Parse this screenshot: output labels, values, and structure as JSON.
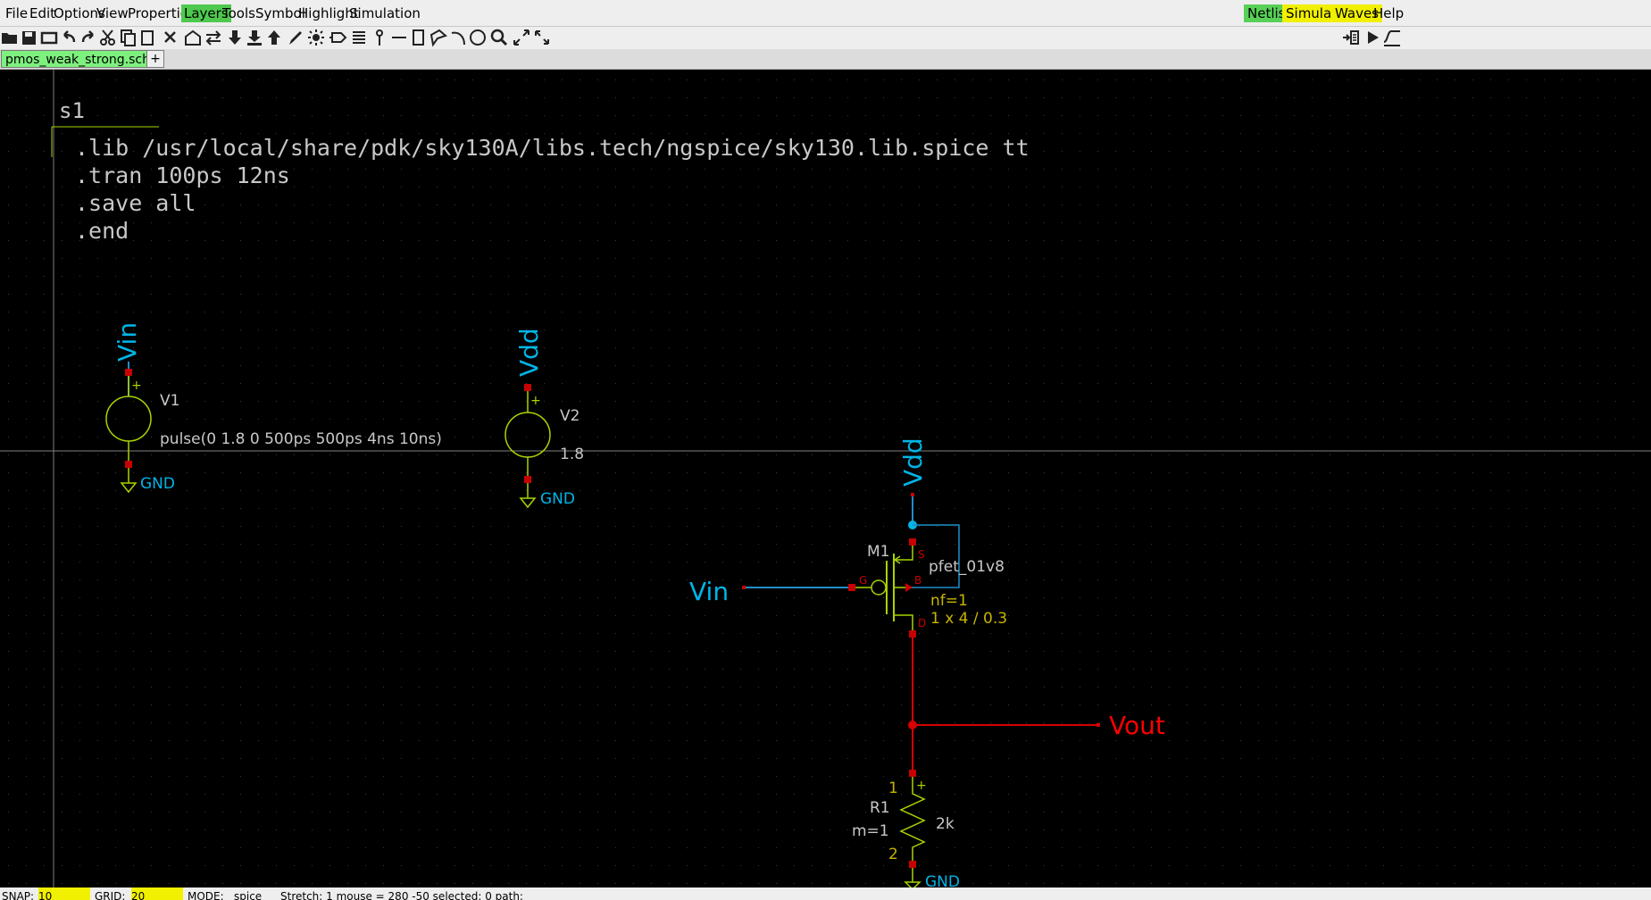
{
  "menu": {
    "items": [
      "File",
      "Edit",
      "Options",
      "View",
      "Properties",
      "Layers",
      "Tools",
      "Symbol",
      "Highlight",
      "Simulation"
    ],
    "highlighted": "Layers",
    "right_items": [
      "Netlist",
      "Simulate",
      "Waves",
      "Help"
    ]
  },
  "toolbar": {
    "icons": [
      "open-folder-icon",
      "save-icon",
      "save-as-icon",
      "undo-icon",
      "redo-icon",
      "cut-icon",
      "copy-icon",
      "delete-icon",
      "insert-symbol-icon",
      "swap-icon",
      "push-down-icon",
      "pop-icon",
      "push-up-icon",
      "pen-icon",
      "highlight-icon",
      "netlabel-icon",
      "list-icon",
      "pin-icon",
      "wire-icon",
      "rectangle-icon",
      "polygon-icon",
      "arc-icon",
      "circle-icon",
      "zoom-icon",
      "zoom-full-icon",
      "fullscreen-icon"
    ],
    "right_icons": [
      "netlist-tool-icon",
      "simulate-play-icon",
      "waves-icon"
    ]
  },
  "tabs": {
    "active": "pmos_weak_strong.sch",
    "add_label": "+"
  },
  "schematic": {
    "code_block": {
      "title": "s1",
      "lines": [
        ".lib /usr/local/share/pdk/sky130A/libs.tech/ngspice/sky130.lib.spice tt",
        ".tran 100ps 12ns",
        ".save all",
        ".end"
      ]
    },
    "v1": {
      "net_label": "Vin",
      "name": "V1",
      "value": "pulse(0 1.8 0 500ps 500ps 4ns 10ns)",
      "plus": "+",
      "gnd": "GND"
    },
    "v2": {
      "net_label": "Vdd",
      "name": "V2",
      "value": "1.8",
      "plus": "+",
      "gnd": "GND"
    },
    "m1": {
      "supply_label": "Vdd",
      "name": "M1",
      "model": "pfet_01v8",
      "nf": "nf=1",
      "size": "1 x 4 / 0.3",
      "pin_s": "S",
      "pin_g": "G",
      "pin_b": "B",
      "pin_d": "D",
      "gate_label": "Vin"
    },
    "vout_label": "Vout",
    "r1": {
      "name": "R1",
      "mult": "m=1",
      "value": "2k",
      "pin1": "1",
      "pin2": "2",
      "plus": "+",
      "gnd": "GND"
    },
    "colors": {
      "net_label": "#00b5e8",
      "wire_blue": "#1e8fc8",
      "wire_red": "#d60000",
      "symbol_green": "#a8d400",
      "symbol_yellow": "#c8b400",
      "pin_red": "#c80000",
      "code_text": "#c8c8c8"
    }
  },
  "status": {
    "snap_label": "SNAP:",
    "snap_value": "10",
    "grid_label": "GRID:",
    "grid_value": "20",
    "mode_label": "MODE:",
    "mode_value": "spice",
    "info": "Stretch: 1  mouse = 280 -50  selected: 0 path:"
  }
}
